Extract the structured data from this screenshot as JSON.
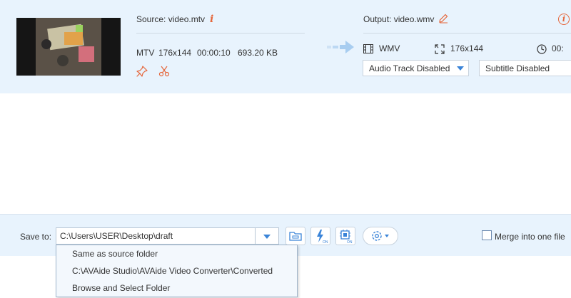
{
  "source": {
    "title": "Source: video.mtv",
    "format": "MTV",
    "resolution": "176x144",
    "duration": "00:00:10",
    "size": "693.20 KB"
  },
  "output": {
    "title": "Output: video.wmv",
    "format": "WMV",
    "resolution": "176x144",
    "duration": "00:"
  },
  "audio_track": {
    "selected": "Audio Track Disabled"
  },
  "subtitle": {
    "selected": "Subtitle Disabled"
  },
  "bottom": {
    "save_label": "Save to:",
    "path": "C:\\Users\\USER\\Desktop\\draft",
    "merge_label": "Merge into one file",
    "merge_checked": false
  },
  "save_menu": {
    "items": [
      "Same as source folder",
      "C:\\AVAide Studio\\AVAide Video Converter\\Converted",
      "Browse and Select Folder"
    ]
  },
  "icons": {
    "info": "info-icon",
    "pin": "star-pin-icon",
    "cut": "scissors-icon",
    "edit": "pencil-icon",
    "warning": "warning-icon",
    "film": "film-icon",
    "expand": "expand-icon",
    "clock": "clock-icon",
    "folder": "folder-icon",
    "hw_accel": "lightning-on-icon",
    "gpu": "chip-on-icon",
    "settings": "gear-icon"
  },
  "colors": {
    "accent": "#3a84d8",
    "warning": "#e5673c",
    "panel": "#e8f3fd"
  }
}
